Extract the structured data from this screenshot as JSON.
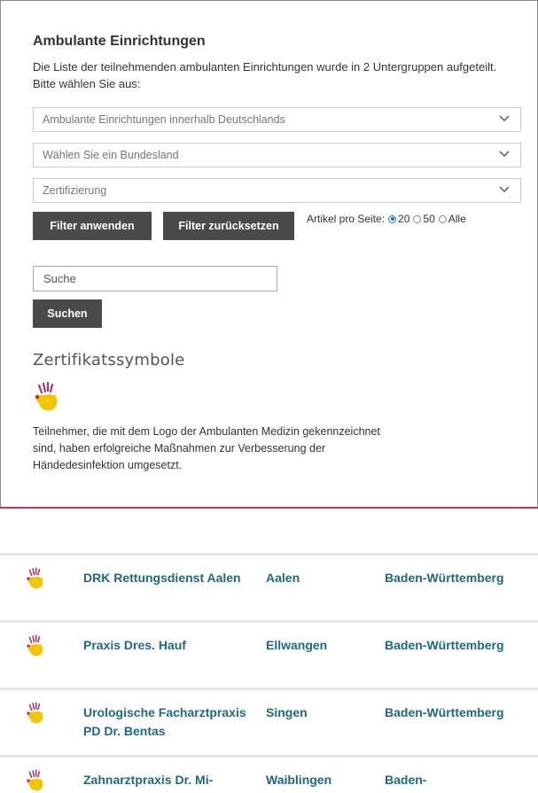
{
  "filter": {
    "title": "Ambulante Einrichtungen",
    "description": "Die Liste der teilnehmenden ambulanten Einrichtungen wurde in 2 Untergruppen aufgeteilt. Bitte wählen Sie aus:",
    "select_group": "Ambulante Einrichtungen innerhalb Deutschlands",
    "select_state": "Wählen Sie ein Bundesland",
    "select_cert": "Zertifizierung",
    "apply_label": "Filter anwenden",
    "reset_label": "Filter zurücksetzen",
    "per_page_label": "Artikel pro Seite:",
    "per_page_options": [
      "20",
      "50",
      "Alle"
    ],
    "per_page_selected": "20"
  },
  "search": {
    "placeholder": "Suche",
    "button_label": "Suchen"
  },
  "certificates": {
    "heading": "Zertifikatssymbole",
    "icon": "hand-hygiene-logo-icon",
    "description": "Teilnehmer, die mit dem Logo der Ambulanten Medizin gekennzeichnet sind, haben erfolgreiche Maßnahmen zur Verbesserung der Händedesinfektion umgesetzt."
  },
  "colors": {
    "accent_line": "#c9305a",
    "link": "#1d6a80",
    "button": "#4a4a4a"
  },
  "results": [
    {
      "name": "DRK Rettungsdienst Aalen",
      "city": "Aalen",
      "state": "Baden-Württemberg"
    },
    {
      "name": "Praxis Dres. Hauf",
      "city": "Ellwangen",
      "state": "Baden-Württemberg"
    },
    {
      "name": "Urologische Facharztpraxis PD Dr. Bentas",
      "city": "Singen",
      "state": "Baden-Württemberg"
    },
    {
      "name": "Zahnarztpraxis Dr. Mi-",
      "city": "Waiblingen",
      "state": "Baden-"
    }
  ]
}
